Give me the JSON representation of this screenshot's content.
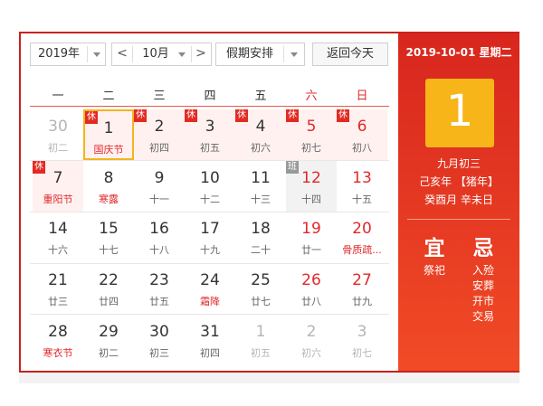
{
  "toolbar": {
    "year_label": "2019年",
    "month_label": "10月",
    "holiday_label": "假期安排",
    "today_button": "返回今天",
    "prev_arrow": "<",
    "next_arrow": ">"
  },
  "weekdays": [
    "一",
    "二",
    "三",
    "四",
    "五",
    "六",
    "日"
  ],
  "accent_color": "#d8261e",
  "badge_holiday": "休",
  "badge_work": "班",
  "days": [
    {
      "num": "30",
      "sub": "初二",
      "style": "grey"
    },
    {
      "num": "1",
      "sub": "国庆节",
      "style": "holiday-red",
      "badge": "休",
      "selected": true
    },
    {
      "num": "2",
      "sub": "初四",
      "style": "holiday",
      "badge": "休"
    },
    {
      "num": "3",
      "sub": "初五",
      "style": "holiday",
      "badge": "休"
    },
    {
      "num": "4",
      "sub": "初六",
      "style": "holiday",
      "badge": "休"
    },
    {
      "num": "5",
      "sub": "初七",
      "style": "weekend-holiday",
      "badge": "休"
    },
    {
      "num": "6",
      "sub": "初八",
      "style": "weekend-holiday",
      "badge": "休"
    },
    {
      "num": "7",
      "sub": "重阳节",
      "style": "holiday-red",
      "badge": "休"
    },
    {
      "num": "8",
      "sub": "寒露",
      "style": "term"
    },
    {
      "num": "9",
      "sub": "十一",
      "style": "normal"
    },
    {
      "num": "10",
      "sub": "十二",
      "style": "normal"
    },
    {
      "num": "11",
      "sub": "十三",
      "style": "normal"
    },
    {
      "num": "12",
      "sub": "十四",
      "style": "workday",
      "badge": "班"
    },
    {
      "num": "13",
      "sub": "十五",
      "style": "weekend"
    },
    {
      "num": "14",
      "sub": "十六",
      "style": "normal"
    },
    {
      "num": "15",
      "sub": "十七",
      "style": "normal"
    },
    {
      "num": "16",
      "sub": "十八",
      "style": "normal"
    },
    {
      "num": "17",
      "sub": "十九",
      "style": "normal"
    },
    {
      "num": "18",
      "sub": "二十",
      "style": "normal"
    },
    {
      "num": "19",
      "sub": "廿一",
      "style": "weekend"
    },
    {
      "num": "20",
      "sub": "骨质疏...",
      "style": "weekend-red"
    },
    {
      "num": "21",
      "sub": "廿三",
      "style": "normal"
    },
    {
      "num": "22",
      "sub": "廿四",
      "style": "normal"
    },
    {
      "num": "23",
      "sub": "廿五",
      "style": "normal"
    },
    {
      "num": "24",
      "sub": "霜降",
      "style": "term"
    },
    {
      "num": "25",
      "sub": "廿七",
      "style": "normal"
    },
    {
      "num": "26",
      "sub": "廿八",
      "style": "weekend"
    },
    {
      "num": "27",
      "sub": "廿九",
      "style": "weekend"
    },
    {
      "num": "28",
      "sub": "寒衣节",
      "style": "term"
    },
    {
      "num": "29",
      "sub": "初二",
      "style": "normal"
    },
    {
      "num": "30",
      "sub": "初三",
      "style": "normal"
    },
    {
      "num": "31",
      "sub": "初四",
      "style": "normal"
    },
    {
      "num": "1",
      "sub": "初五",
      "style": "grey"
    },
    {
      "num": "2",
      "sub": "初六",
      "style": "grey"
    },
    {
      "num": "3",
      "sub": "初七",
      "style": "grey"
    }
  ],
  "detail": {
    "date_line": "2019-10-01 星期二",
    "day_number": "1",
    "lunar_date": "九月初三",
    "year_gz": "己亥年 【猪年】",
    "month_day_gz": "癸酉月 辛未日",
    "yi_label": "宜",
    "ji_label": "忌",
    "yi_items": [
      "祭祀"
    ],
    "ji_items": [
      "入殓",
      "安葬",
      "开市",
      "交易"
    ]
  }
}
